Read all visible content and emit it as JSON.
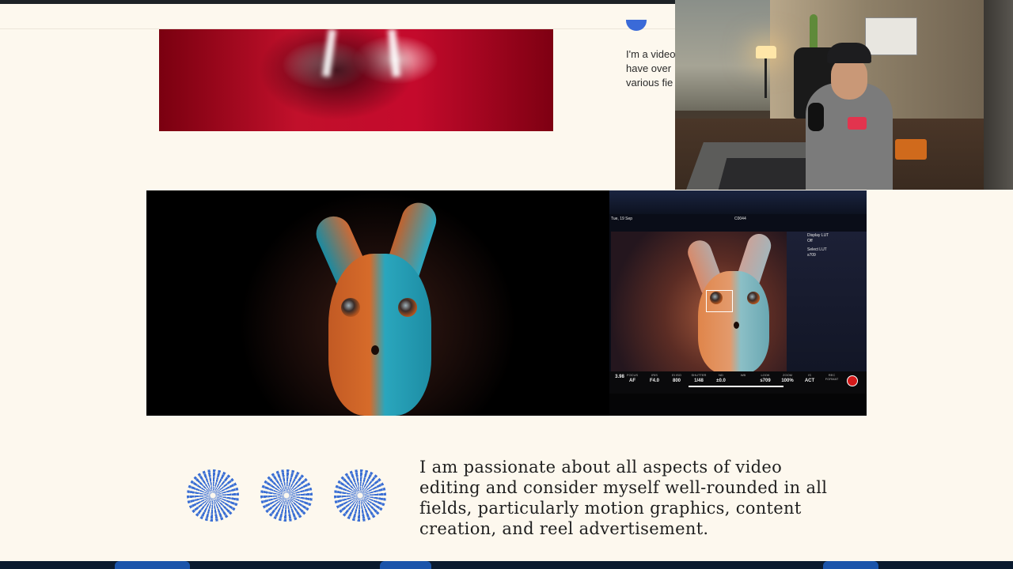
{
  "about": {
    "lines": [
      "I'm a video",
      "have over",
      "various fie"
    ]
  },
  "monitor": {
    "status_left": "Tue, 19 Sep",
    "status_mid": "C0044",
    "display_lut_label": "Display LUT",
    "display_lut_value": "Off",
    "select_lut_label": "Select LUT",
    "select_lut_value": "s709",
    "bar": [
      {
        "label": "",
        "value": "3.98"
      },
      {
        "label": "FOCUS",
        "value": "AF"
      },
      {
        "label": "IRIS",
        "value": "F4.0"
      },
      {
        "label": "EI ISO",
        "value": "800"
      },
      {
        "label": "SHUTTER",
        "value": "1/48"
      },
      {
        "label": "ND",
        "value": "±0.0"
      },
      {
        "label": "WB",
        "value": ""
      },
      {
        "label": "LOOK",
        "value": "s709"
      },
      {
        "label": "ZOOM",
        "value": "100%"
      },
      {
        "label": "IS",
        "value": "ACT"
      },
      {
        "label": "REC FORMAT",
        "value": ""
      }
    ]
  },
  "passion_text": {
    "lines": [
      "I am passionate about all aspects of video",
      "editing and consider myself well-rounded in all",
      "fields, particularly motion graphics, content",
      "creation, and reel advertisement."
    ]
  },
  "colors": {
    "page_background": "#fdf8ee",
    "accent_blue": "#3b6fd4",
    "text": "#1f1f1f"
  },
  "icons": [
    "spiral-icon",
    "spiral-icon",
    "spiral-icon",
    "record-icon",
    "focus-box-icon"
  ]
}
